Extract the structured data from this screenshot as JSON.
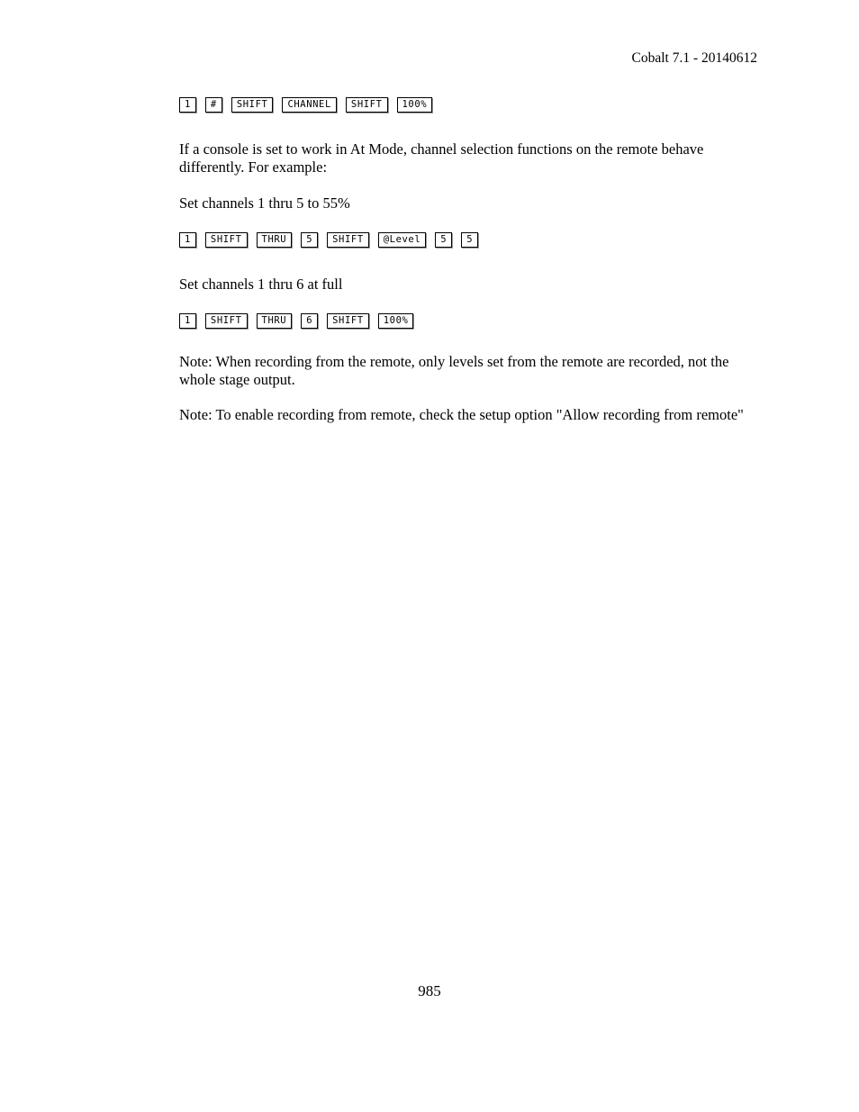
{
  "header": {
    "revision": "Cobalt 7.1 - 20140612"
  },
  "body": {
    "key_sequence_1": [
      {
        "label": "1"
      },
      {
        "label": "#"
      },
      {
        "label": "SHIFT"
      },
      {
        "label": "CHANNEL"
      },
      {
        "label": "SHIFT"
      },
      {
        "label": "100%"
      }
    ],
    "paragraph_1": "If a console is set to work in At Mode, channel selection functions on the remote behave differently. For example:",
    "example_1_caption": "Set channels 1 thru 5 to 55%",
    "key_sequence_2": [
      {
        "label": "1"
      },
      {
        "label": "SHIFT"
      },
      {
        "label": "THRU"
      },
      {
        "label": "5"
      },
      {
        "label": "SHIFT"
      },
      {
        "label": "@Level"
      },
      {
        "label": "5"
      },
      {
        "label": "5"
      }
    ],
    "example_2_caption": "Set channels 1 thru 6 at full",
    "key_sequence_3": [
      {
        "label": "1"
      },
      {
        "label": "SHIFT"
      },
      {
        "label": "THRU"
      },
      {
        "label": "6"
      },
      {
        "label": "SHIFT"
      },
      {
        "label": "100%"
      }
    ],
    "note_1": "Note: When recording from the remote, only levels set from the remote are recorded, not the whole stage output.",
    "note_2": "Note: To enable recording from remote, check the setup option \"Allow recording from remote\""
  },
  "footer": {
    "page_number": "985"
  }
}
